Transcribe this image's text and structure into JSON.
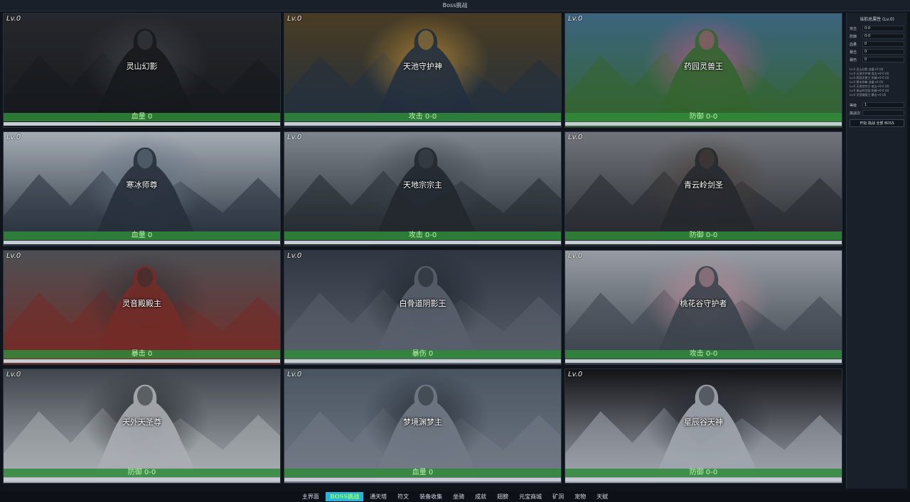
{
  "window": {
    "title": "Boss挑战"
  },
  "bosses": [
    {
      "level": "Lv.0",
      "name": "灵山幻影",
      "stat": "血量 0",
      "palette": [
        "#2e3136",
        "#4d5258",
        "#1c1f24"
      ]
    },
    {
      "level": "Lv.0",
      "name": "天池守护神",
      "stat": "攻击 0-0",
      "palette": [
        "#5a4a2c",
        "#d9a441",
        "#2a3a4c"
      ]
    },
    {
      "level": "Lv.0",
      "name": "药园灵兽王",
      "stat": "防御 0-0",
      "palette": [
        "#4a7a9c",
        "#d46fa3",
        "#3f7b3a"
      ]
    },
    {
      "level": "Lv.0",
      "name": "寒冰师尊",
      "stat": "血量 0",
      "palette": [
        "#c9d2dc",
        "#7d8fa3",
        "#2f3a48"
      ]
    },
    {
      "level": "Lv.0",
      "name": "天地宗宗主",
      "stat": "攻击 0-0",
      "palette": [
        "#9aa3ad",
        "#4c5560",
        "#2a3138"
      ]
    },
    {
      "level": "Lv.0",
      "name": "青云岭剑圣",
      "stat": "防御 0-0",
      "palette": [
        "#8a8f96",
        "#5a4e46",
        "#2e3238"
      ]
    },
    {
      "level": "Lv.0",
      "name": "灵音殿殿主",
      "stat": "暴击 0",
      "palette": [
        "#5e6166",
        "#3b3b3e",
        "#8e3530"
      ]
    },
    {
      "level": "Lv.0",
      "name": "白骨道阴影王",
      "stat": "暴伤 0",
      "palette": [
        "#3a4250",
        "#252b34",
        "#6d7684"
      ]
    },
    {
      "level": "Lv.0",
      "name": "桃花谷守护者",
      "stat": "攻击 0-0",
      "palette": [
        "#b9bfc7",
        "#e3a9b8",
        "#49525e"
      ]
    },
    {
      "level": "Lv.0",
      "name": "天外天圣尊",
      "stat": "防御 0-0",
      "palette": [
        "#4f565e",
        "#2a2f35",
        "#cfd5db"
      ]
    },
    {
      "level": "Lv.0",
      "name": "梦境渊梦主",
      "stat": "血量 0",
      "palette": [
        "#5a6876",
        "#2c3540",
        "#8b95a3"
      ]
    },
    {
      "level": "Lv.0",
      "name": "星辰谷天神",
      "stat": "防御 0-0",
      "palette": [
        "#16181d",
        "#2a2e36",
        "#c4cbd6"
      ]
    }
  ],
  "side_panel": {
    "title": "当前总属性 (Lv.0)",
    "rows": [
      {
        "key": "攻击",
        "value": "0-0"
      },
      {
        "key": "防御",
        "value": "0-0"
      },
      {
        "key": "血量",
        "value": "0"
      },
      {
        "key": "暴击",
        "value": "0"
      },
      {
        "key": "暴伤",
        "value": "0"
      }
    ],
    "log": [
      "Lv.0 灵山幻影 血量+0 (0)",
      "Lv.0 天池守护神 攻击+0-0 (0)",
      "Lv.0 药园灵兽王 防御+0-0 (0)",
      "Lv.0 寒冰师尊 血量+0 (0)",
      "Lv.0 天地宗宗主 攻击+0-0 (0)",
      "Lv.0 青云岭剑圣 防御+0-0 (0)",
      "Lv.0 灵音殿殿主 暴击+0 (0)"
    ],
    "input1": {
      "key": "等级",
      "value": "1"
    },
    "input2": {
      "key": "挑战次",
      "value": ""
    },
    "button_label": "开始 挑战 全部 BOSS"
  },
  "bottom_tabs": [
    {
      "label": "主界面",
      "active": false
    },
    {
      "label": "BOSS挑战",
      "active": true
    },
    {
      "label": "通天塔",
      "active": false
    },
    {
      "label": "符文",
      "active": false
    },
    {
      "label": "装备收集",
      "active": false
    },
    {
      "label": "坐骑",
      "active": false
    },
    {
      "label": "成就",
      "active": false
    },
    {
      "label": "翅膀",
      "active": false
    },
    {
      "label": "元宝商城",
      "active": false
    },
    {
      "label": "矿洞",
      "active": false
    },
    {
      "label": "宠物",
      "active": false
    },
    {
      "label": "天赋",
      "active": false
    }
  ]
}
